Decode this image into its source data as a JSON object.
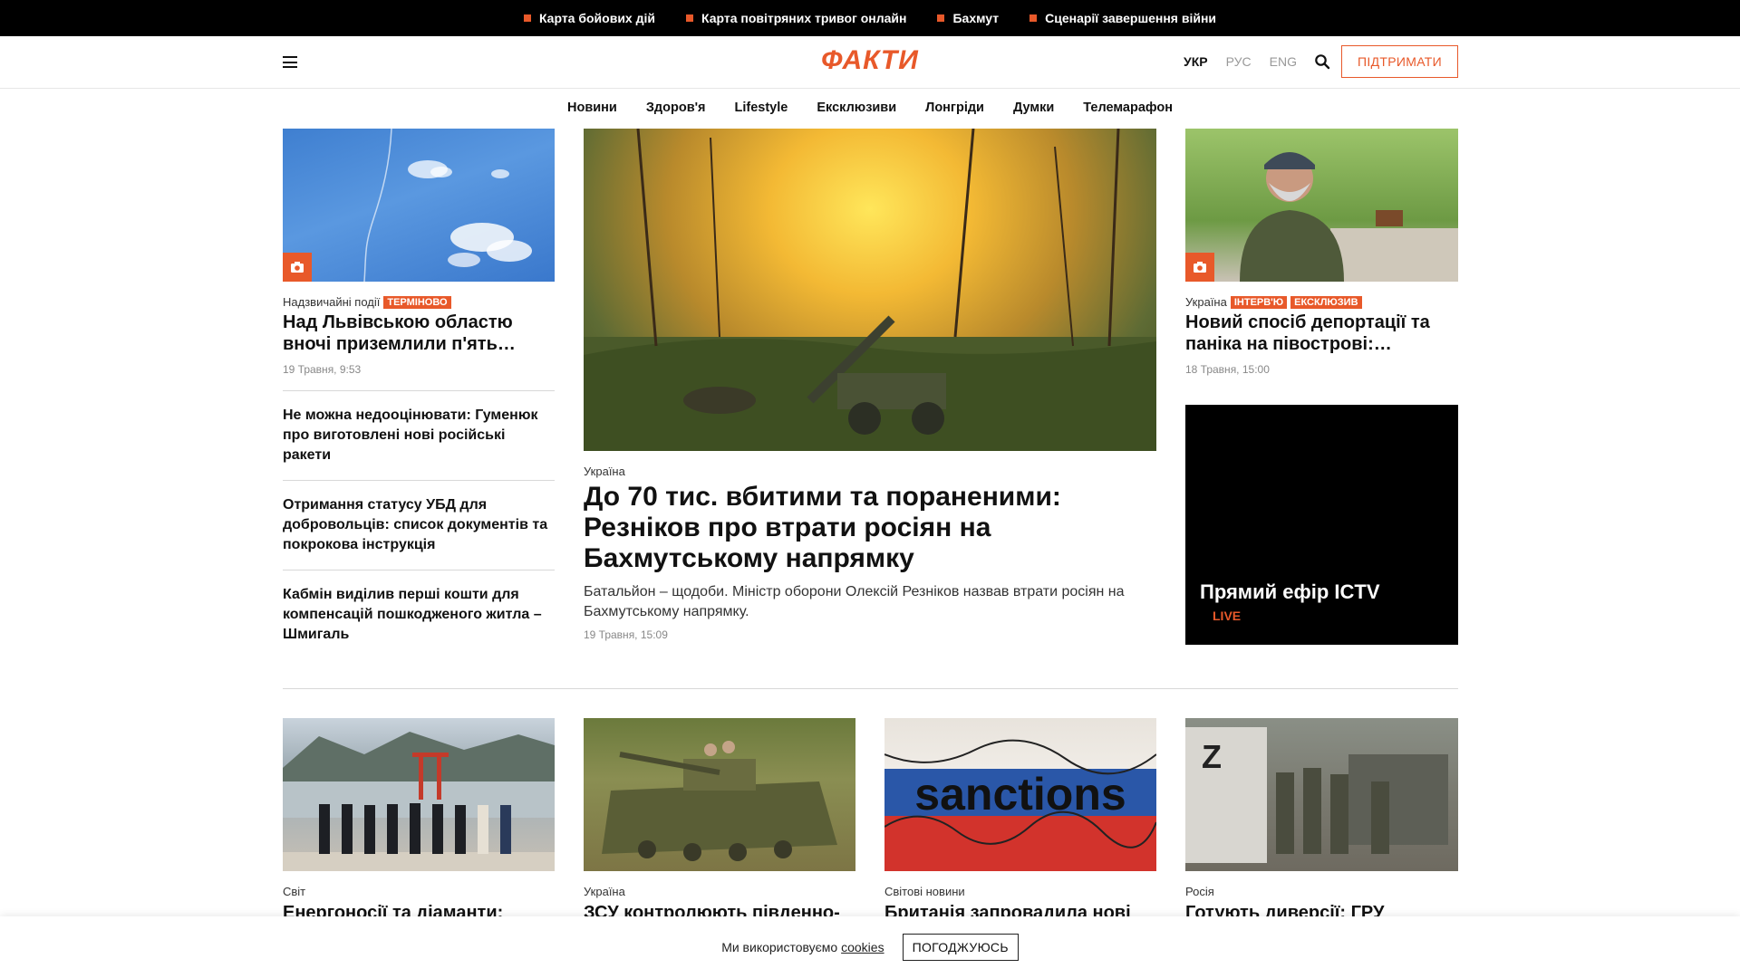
{
  "topbar": {
    "links": [
      "Карта бойових дій",
      "Карта повітряних тривог онлайн",
      "Бахмут",
      "Сценарії завершення війни"
    ]
  },
  "header": {
    "logo": "ФАКТИ",
    "languages": [
      "УКР",
      "РУС",
      "ENG"
    ],
    "active_language": "УКР",
    "support_label": "ПІДТРИМАТИ"
  },
  "nav": {
    "items": [
      "Новини",
      "Здоров'я",
      "Lifestyle",
      "Ексклюзиви",
      "Лонгріди",
      "Думки",
      "Телемарафон"
    ]
  },
  "left_feature": {
    "category": "Надзвичайні події",
    "tag": "ТЕРМІНОВО",
    "title": "Над Львівською областю вночі приземлили п'ять…",
    "date": "19 Травня, 9:53"
  },
  "left_list": [
    "Не можна недооцінювати: Гуменюк про виготовлені нові російські ракети",
    "Отримання статусу УБД для добровольців: список документів та покрокова інструкція",
    "Кабмін виділив перші кошти для компенсацій пошкодженого житла – Шмигаль"
  ],
  "main_story": {
    "category": "Україна",
    "title": "До 70 тис. вбитими та пораненими: Резніков про втрати росіян на Бахмутському напрямку",
    "summary": "Батальйон – щодоби. Міністр оборони Олексій Резніков назвав втрати росіян на Бахмутському напрямку.",
    "date": "19 Травня, 15:09"
  },
  "right_feature": {
    "category": "Україна",
    "tags": [
      "ІНТЕРВ'Ю",
      "ЕКСКЛЮЗИВ"
    ],
    "title": "Новий спосіб депортації та паніка на півострові:…",
    "date": "18 Травня, 15:00"
  },
  "live": {
    "title": "Прямий ефір ICTV",
    "label": "LIVE"
  },
  "bottom_cards": [
    {
      "category": "Світ",
      "title": "Енергоносії та діаманти:"
    },
    {
      "category": "Україна",
      "title": "ЗСУ контролюють південно-"
    },
    {
      "category": "Світові новини",
      "title": "Британія запровадила нові"
    },
    {
      "category": "Росія",
      "title": "Готують диверсії: ГРУ"
    }
  ],
  "sanctions_text": "sanctions",
  "cookie": {
    "text": "Ми використовуємо",
    "link": "cookies",
    "button": "ПОГОДЖУЮСЬ"
  },
  "colors": {
    "accent": "#e8592a",
    "topbar_bg": "#000000"
  }
}
